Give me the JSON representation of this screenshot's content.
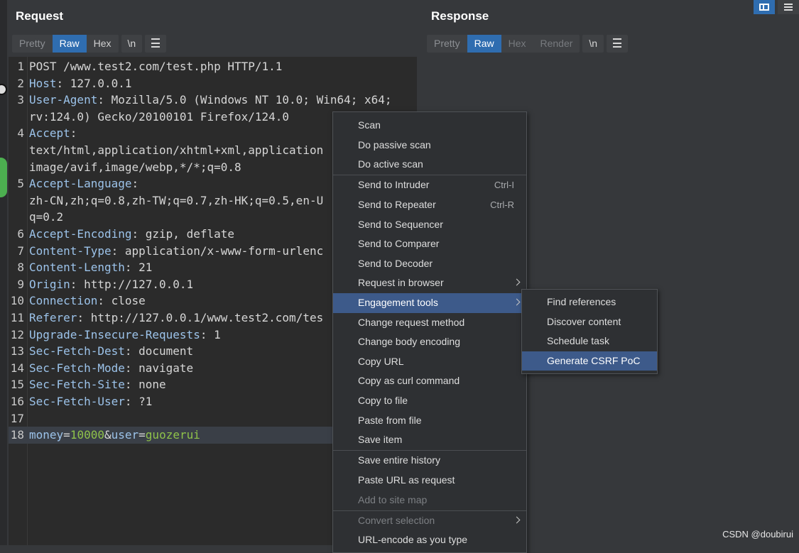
{
  "request": {
    "title": "Request",
    "tabs": [
      "Pretty",
      "Raw",
      "Hex"
    ],
    "active_tab": "Raw",
    "newline_btn": "\\n",
    "lines": [
      {
        "n": "1",
        "key": "",
        "val": "POST /www.test2.com/test.php HTTP/1.1"
      },
      {
        "n": "2",
        "key": "Host",
        "val": ": 127.0.0.1"
      },
      {
        "n": "3",
        "key": "User-Agent",
        "val": ": Mozilla/5.0 (Windows NT 10.0; Win64; x64;"
      },
      {
        "n": "",
        "key": "",
        "val": "rv:124.0) Gecko/20100101 Firefox/124.0"
      },
      {
        "n": "4",
        "key": "Accept",
        "val": ":"
      },
      {
        "n": "",
        "key": "",
        "val": "text/html,application/xhtml+xml,application"
      },
      {
        "n": "",
        "key": "",
        "val": "image/avif,image/webp,*/*;q=0.8"
      },
      {
        "n": "5",
        "key": "Accept-Language",
        "val": ":"
      },
      {
        "n": "",
        "key": "",
        "val": "zh-CN,zh;q=0.8,zh-TW;q=0.7,zh-HK;q=0.5,en-U"
      },
      {
        "n": "",
        "key": "",
        "val": "q=0.2"
      },
      {
        "n": "6",
        "key": "Accept-Encoding",
        "val": ": gzip, deflate"
      },
      {
        "n": "7",
        "key": "Content-Type",
        "val": ": application/x-www-form-urlenc"
      },
      {
        "n": "8",
        "key": "Content-Length",
        "val": ": 21"
      },
      {
        "n": "9",
        "key": "Origin",
        "val": ": http://127.0.0.1"
      },
      {
        "n": "10",
        "key": "Connection",
        "val": ": close"
      },
      {
        "n": "11",
        "key": "Referer",
        "val": ": http://127.0.0.1/www.test2.com/tes"
      },
      {
        "n": "12",
        "key": "Upgrade-Insecure-Requests",
        "val": ": 1"
      },
      {
        "n": "13",
        "key": "Sec-Fetch-Dest",
        "val": ": document"
      },
      {
        "n": "14",
        "key": "Sec-Fetch-Mode",
        "val": ": navigate"
      },
      {
        "n": "15",
        "key": "Sec-Fetch-Site",
        "val": ": none"
      },
      {
        "n": "16",
        "key": "Sec-Fetch-User",
        "val": ": ?1"
      },
      {
        "n": "17",
        "key": "",
        "val": ""
      }
    ],
    "body_line": {
      "n": "18",
      "p1": "money",
      "e1": "=",
      "v1": "10000",
      "amp": "&",
      "p2": "user",
      "e2": "=",
      "v2": "guozerui"
    }
  },
  "response": {
    "title": "Response",
    "tabs": [
      "Pretty",
      "Raw",
      "Hex",
      "Render"
    ],
    "active_tab": "Raw",
    "newline_btn": "\\n"
  },
  "context_menu": {
    "items": [
      {
        "label": "Scan",
        "shortcut": "",
        "arrow": false,
        "state": "normal"
      },
      {
        "label": "Do passive scan",
        "shortcut": "",
        "arrow": false,
        "state": "normal"
      },
      {
        "label": "Do active scan",
        "shortcut": "",
        "arrow": false,
        "state": "normal",
        "sep_after": true
      },
      {
        "label": "Send to Intruder",
        "shortcut": "Ctrl-I",
        "arrow": false,
        "state": "normal"
      },
      {
        "label": "Send to Repeater",
        "shortcut": "Ctrl-R",
        "arrow": false,
        "state": "normal"
      },
      {
        "label": "Send to Sequencer",
        "shortcut": "",
        "arrow": false,
        "state": "normal"
      },
      {
        "label": "Send to Comparer",
        "shortcut": "",
        "arrow": false,
        "state": "normal"
      },
      {
        "label": "Send to Decoder",
        "shortcut": "",
        "arrow": false,
        "state": "normal"
      },
      {
        "label": "Request in browser",
        "shortcut": "",
        "arrow": true,
        "state": "normal"
      },
      {
        "label": "Engagement tools",
        "shortcut": "",
        "arrow": true,
        "state": "selected"
      },
      {
        "label": "Change request method",
        "shortcut": "",
        "arrow": false,
        "state": "normal"
      },
      {
        "label": "Change body encoding",
        "shortcut": "",
        "arrow": false,
        "state": "normal"
      },
      {
        "label": "Copy URL",
        "shortcut": "",
        "arrow": false,
        "state": "normal"
      },
      {
        "label": "Copy as curl command",
        "shortcut": "",
        "arrow": false,
        "state": "normal"
      },
      {
        "label": "Copy to file",
        "shortcut": "",
        "arrow": false,
        "state": "normal"
      },
      {
        "label": "Paste from file",
        "shortcut": "",
        "arrow": false,
        "state": "normal"
      },
      {
        "label": "Save item",
        "shortcut": "",
        "arrow": false,
        "state": "normal",
        "sep_after": true
      },
      {
        "label": "Save entire history",
        "shortcut": "",
        "arrow": false,
        "state": "normal"
      },
      {
        "label": "Paste URL as request",
        "shortcut": "",
        "arrow": false,
        "state": "normal"
      },
      {
        "label": "Add to site map",
        "shortcut": "",
        "arrow": false,
        "state": "disabled",
        "sep_after": true
      },
      {
        "label": "Convert selection",
        "shortcut": "",
        "arrow": true,
        "state": "disabled"
      },
      {
        "label": "URL-encode as you type",
        "shortcut": "",
        "arrow": false,
        "state": "normal"
      }
    ]
  },
  "submenu": {
    "items": [
      {
        "label": "Find references",
        "state": "normal"
      },
      {
        "label": "Discover content",
        "state": "normal"
      },
      {
        "label": "Schedule task",
        "state": "normal"
      },
      {
        "label": "Generate CSRF PoC",
        "state": "selected"
      }
    ]
  },
  "watermark": "CSDN @doubirui",
  "colors": {
    "accent": "#2f6db0",
    "menu_selected": "#3d5a8a",
    "body_value": "#8fc24a"
  }
}
